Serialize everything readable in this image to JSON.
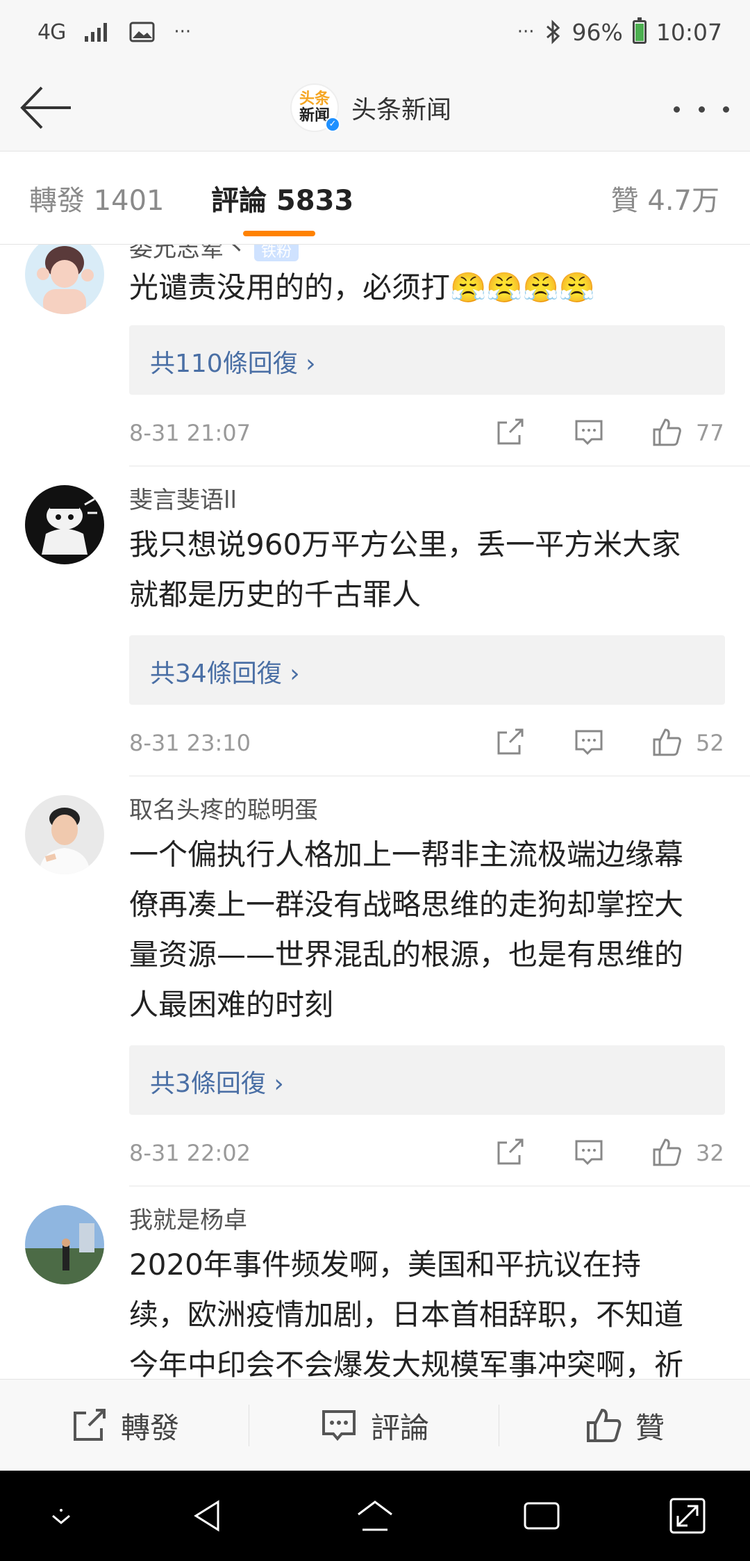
{
  "status_bar": {
    "network": "4G",
    "battery": "96%",
    "time": "10:07",
    "dots": "···"
  },
  "nav": {
    "channel_name": "头条新闻",
    "logo_line1": "头条",
    "logo_line2": "新闻"
  },
  "tabs": {
    "repost": "轉發 1401",
    "comments": "評論 5833",
    "likes": "贊 4.7万"
  },
  "comments": [
    {
      "username": "委允志荤丶",
      "badge": "铁粉",
      "lines": [
        "光谴责没用的的，必须打😤😤😤😤"
      ],
      "replies": "共110條回復 ›",
      "time": "8-31 21:07",
      "likes": "77"
    },
    {
      "username": "斐言斐语ll",
      "lines": [
        "我只想说960万平方公里，丢一平方米大家",
        "就都是历史的千古罪人"
      ],
      "replies": "共34條回復 ›",
      "time": "8-31 23:10",
      "likes": "52"
    },
    {
      "username": "取名头疼的聪明蛋",
      "lines": [
        "一个偏执行人格加上一帮非主流极端边缘幕",
        "僚再凑上一群没有战略思维的走狗却掌控大",
        "量资源——世界混乱的根源，也是有思维的",
        "人最困难的时刻"
      ],
      "replies": "共3條回復 ›",
      "time": "8-31 22:02",
      "likes": "32"
    },
    {
      "username": "我就是杨卓",
      "lines": [
        "2020年事件频发啊，美国和平抗议在持",
        "续，欧洲疫情加剧，日本首相辞职，不知道",
        "今年中印会不会爆发大规模军事冲突啊，祈"
      ]
    }
  ],
  "bottom_bar": {
    "repost": "轉發",
    "comment": "評論",
    "like": "贊"
  },
  "colors": {
    "accent": "#ff8200",
    "reply_link": "#4a6fa5",
    "meta_gray": "#9a9a9a"
  }
}
